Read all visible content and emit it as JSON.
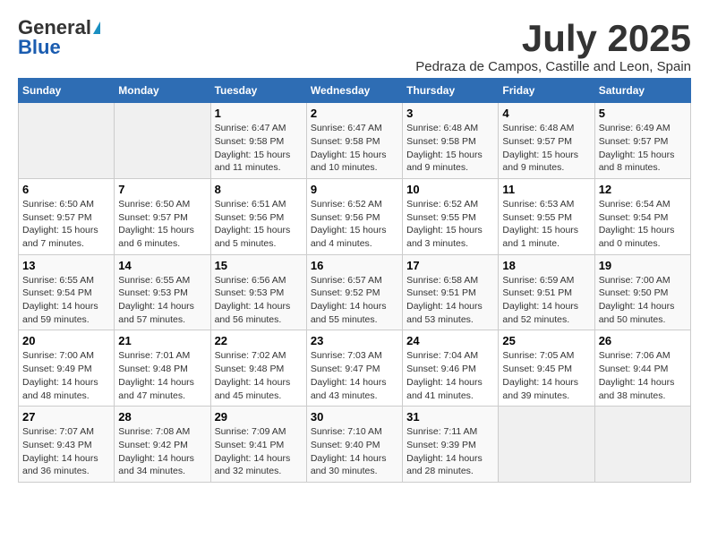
{
  "header": {
    "logo_general": "General",
    "logo_blue": "Blue",
    "month_title": "July 2025",
    "location": "Pedraza de Campos, Castille and Leon, Spain"
  },
  "days_of_week": [
    "Sunday",
    "Monday",
    "Tuesday",
    "Wednesday",
    "Thursday",
    "Friday",
    "Saturday"
  ],
  "weeks": [
    [
      {
        "day": "",
        "sunrise": "",
        "sunset": "",
        "daylight": ""
      },
      {
        "day": "",
        "sunrise": "",
        "sunset": "",
        "daylight": ""
      },
      {
        "day": "1",
        "sunrise": "Sunrise: 6:47 AM",
        "sunset": "Sunset: 9:58 PM",
        "daylight": "Daylight: 15 hours and 11 minutes."
      },
      {
        "day": "2",
        "sunrise": "Sunrise: 6:47 AM",
        "sunset": "Sunset: 9:58 PM",
        "daylight": "Daylight: 15 hours and 10 minutes."
      },
      {
        "day": "3",
        "sunrise": "Sunrise: 6:48 AM",
        "sunset": "Sunset: 9:58 PM",
        "daylight": "Daylight: 15 hours and 9 minutes."
      },
      {
        "day": "4",
        "sunrise": "Sunrise: 6:48 AM",
        "sunset": "Sunset: 9:57 PM",
        "daylight": "Daylight: 15 hours and 9 minutes."
      },
      {
        "day": "5",
        "sunrise": "Sunrise: 6:49 AM",
        "sunset": "Sunset: 9:57 PM",
        "daylight": "Daylight: 15 hours and 8 minutes."
      }
    ],
    [
      {
        "day": "6",
        "sunrise": "Sunrise: 6:50 AM",
        "sunset": "Sunset: 9:57 PM",
        "daylight": "Daylight: 15 hours and 7 minutes."
      },
      {
        "day": "7",
        "sunrise": "Sunrise: 6:50 AM",
        "sunset": "Sunset: 9:57 PM",
        "daylight": "Daylight: 15 hours and 6 minutes."
      },
      {
        "day": "8",
        "sunrise": "Sunrise: 6:51 AM",
        "sunset": "Sunset: 9:56 PM",
        "daylight": "Daylight: 15 hours and 5 minutes."
      },
      {
        "day": "9",
        "sunrise": "Sunrise: 6:52 AM",
        "sunset": "Sunset: 9:56 PM",
        "daylight": "Daylight: 15 hours and 4 minutes."
      },
      {
        "day": "10",
        "sunrise": "Sunrise: 6:52 AM",
        "sunset": "Sunset: 9:55 PM",
        "daylight": "Daylight: 15 hours and 3 minutes."
      },
      {
        "day": "11",
        "sunrise": "Sunrise: 6:53 AM",
        "sunset": "Sunset: 9:55 PM",
        "daylight": "Daylight: 15 hours and 1 minute."
      },
      {
        "day": "12",
        "sunrise": "Sunrise: 6:54 AM",
        "sunset": "Sunset: 9:54 PM",
        "daylight": "Daylight: 15 hours and 0 minutes."
      }
    ],
    [
      {
        "day": "13",
        "sunrise": "Sunrise: 6:55 AM",
        "sunset": "Sunset: 9:54 PM",
        "daylight": "Daylight: 14 hours and 59 minutes."
      },
      {
        "day": "14",
        "sunrise": "Sunrise: 6:55 AM",
        "sunset": "Sunset: 9:53 PM",
        "daylight": "Daylight: 14 hours and 57 minutes."
      },
      {
        "day": "15",
        "sunrise": "Sunrise: 6:56 AM",
        "sunset": "Sunset: 9:53 PM",
        "daylight": "Daylight: 14 hours and 56 minutes."
      },
      {
        "day": "16",
        "sunrise": "Sunrise: 6:57 AM",
        "sunset": "Sunset: 9:52 PM",
        "daylight": "Daylight: 14 hours and 55 minutes."
      },
      {
        "day": "17",
        "sunrise": "Sunrise: 6:58 AM",
        "sunset": "Sunset: 9:51 PM",
        "daylight": "Daylight: 14 hours and 53 minutes."
      },
      {
        "day": "18",
        "sunrise": "Sunrise: 6:59 AM",
        "sunset": "Sunset: 9:51 PM",
        "daylight": "Daylight: 14 hours and 52 minutes."
      },
      {
        "day": "19",
        "sunrise": "Sunrise: 7:00 AM",
        "sunset": "Sunset: 9:50 PM",
        "daylight": "Daylight: 14 hours and 50 minutes."
      }
    ],
    [
      {
        "day": "20",
        "sunrise": "Sunrise: 7:00 AM",
        "sunset": "Sunset: 9:49 PM",
        "daylight": "Daylight: 14 hours and 48 minutes."
      },
      {
        "day": "21",
        "sunrise": "Sunrise: 7:01 AM",
        "sunset": "Sunset: 9:48 PM",
        "daylight": "Daylight: 14 hours and 47 minutes."
      },
      {
        "day": "22",
        "sunrise": "Sunrise: 7:02 AM",
        "sunset": "Sunset: 9:48 PM",
        "daylight": "Daylight: 14 hours and 45 minutes."
      },
      {
        "day": "23",
        "sunrise": "Sunrise: 7:03 AM",
        "sunset": "Sunset: 9:47 PM",
        "daylight": "Daylight: 14 hours and 43 minutes."
      },
      {
        "day": "24",
        "sunrise": "Sunrise: 7:04 AM",
        "sunset": "Sunset: 9:46 PM",
        "daylight": "Daylight: 14 hours and 41 minutes."
      },
      {
        "day": "25",
        "sunrise": "Sunrise: 7:05 AM",
        "sunset": "Sunset: 9:45 PM",
        "daylight": "Daylight: 14 hours and 39 minutes."
      },
      {
        "day": "26",
        "sunrise": "Sunrise: 7:06 AM",
        "sunset": "Sunset: 9:44 PM",
        "daylight": "Daylight: 14 hours and 38 minutes."
      }
    ],
    [
      {
        "day": "27",
        "sunrise": "Sunrise: 7:07 AM",
        "sunset": "Sunset: 9:43 PM",
        "daylight": "Daylight: 14 hours and 36 minutes."
      },
      {
        "day": "28",
        "sunrise": "Sunrise: 7:08 AM",
        "sunset": "Sunset: 9:42 PM",
        "daylight": "Daylight: 14 hours and 34 minutes."
      },
      {
        "day": "29",
        "sunrise": "Sunrise: 7:09 AM",
        "sunset": "Sunset: 9:41 PM",
        "daylight": "Daylight: 14 hours and 32 minutes."
      },
      {
        "day": "30",
        "sunrise": "Sunrise: 7:10 AM",
        "sunset": "Sunset: 9:40 PM",
        "daylight": "Daylight: 14 hours and 30 minutes."
      },
      {
        "day": "31",
        "sunrise": "Sunrise: 7:11 AM",
        "sunset": "Sunset: 9:39 PM",
        "daylight": "Daylight: 14 hours and 28 minutes."
      },
      {
        "day": "",
        "sunrise": "",
        "sunset": "",
        "daylight": ""
      },
      {
        "day": "",
        "sunrise": "",
        "sunset": "",
        "daylight": ""
      }
    ]
  ]
}
